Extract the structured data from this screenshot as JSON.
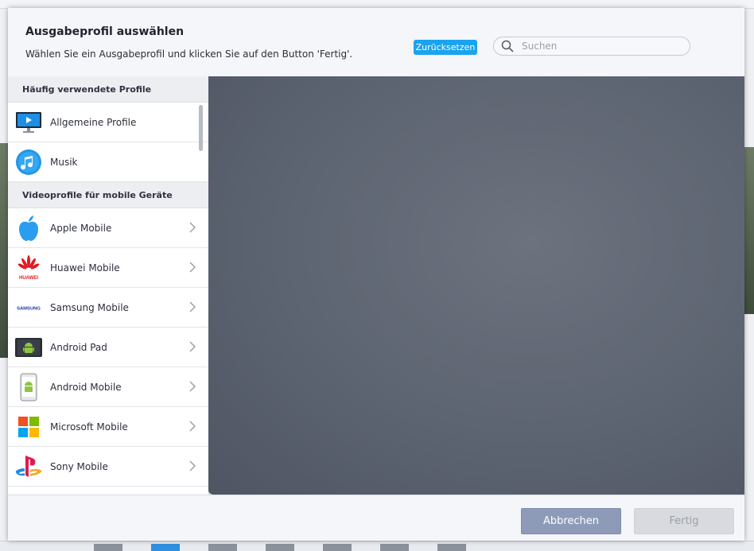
{
  "dialog": {
    "title": "Ausgabeprofil auswählen",
    "subtitle": "Wählen Sie ein Ausgabeprofil und klicken Sie auf den Button 'Fertig'.",
    "reset_label": "Zurücksetzen",
    "search_placeholder": "Suchen",
    "cancel_label": "Abbrechen",
    "done_label": "Fertig"
  },
  "sections": [
    {
      "title": "Häufig verwendete Profile",
      "items": [
        {
          "label": "Allgemeine Profile",
          "icon": "monitor-play-icon"
        },
        {
          "label": "Musik",
          "icon": "music-note-icon"
        }
      ]
    },
    {
      "title": "Videoprofile für mobile Geräte",
      "items": [
        {
          "label": "Apple Mobile",
          "icon": "apple-logo-icon"
        },
        {
          "label": "Huawei Mobile",
          "icon": "huawei-logo-icon",
          "logo_text": "HUAWEI"
        },
        {
          "label": "Samsung Mobile",
          "icon": "samsung-logo-icon",
          "logo_text": "SAMSUNG"
        },
        {
          "label": "Android Pad",
          "icon": "android-pad-icon"
        },
        {
          "label": "Android Mobile",
          "icon": "android-phone-icon"
        },
        {
          "label": "Microsoft Mobile",
          "icon": "microsoft-logo-icon"
        },
        {
          "label": "Sony Mobile",
          "icon": "playstation-logo-icon"
        }
      ]
    }
  ],
  "colors": {
    "accent": "#1aa3f0",
    "cancel_button": "#8e9bb8",
    "done_button_disabled": "#d8dadf",
    "preview_bg": "#5d6471"
  }
}
